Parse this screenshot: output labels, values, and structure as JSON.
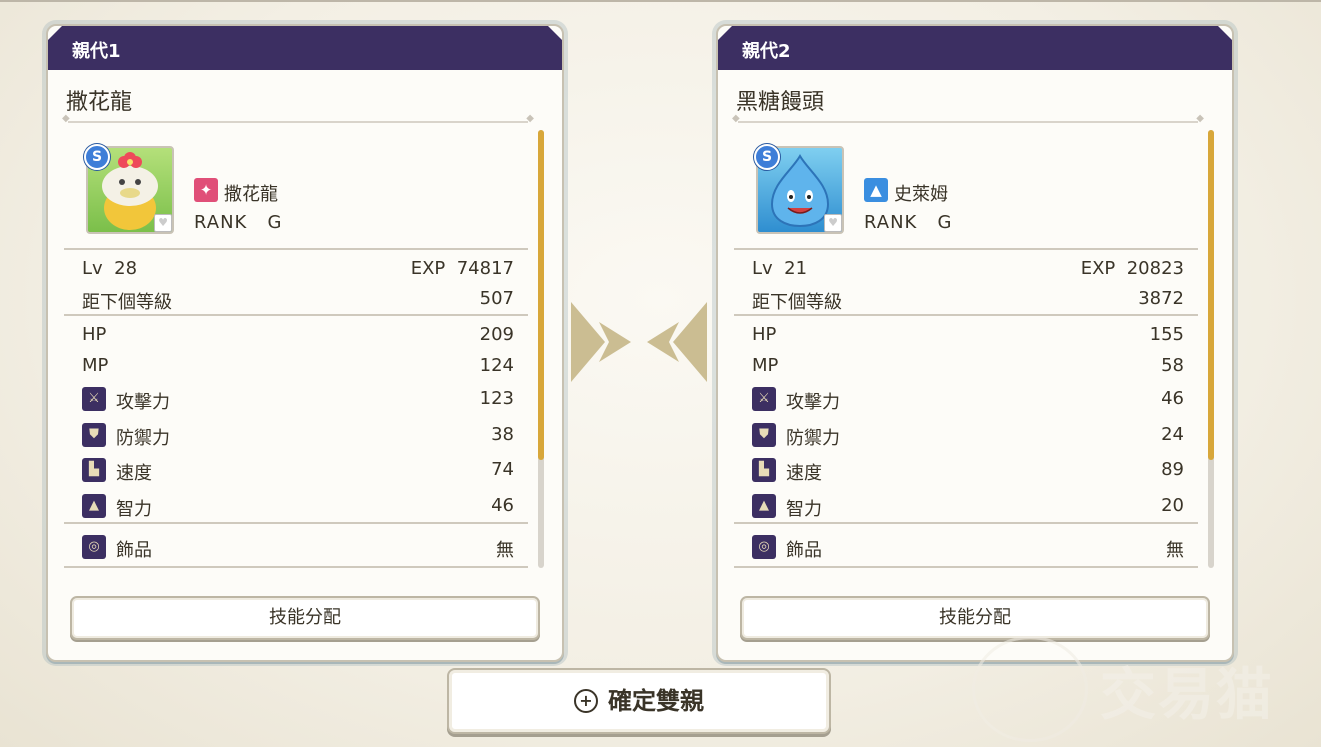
{
  "parents": [
    {
      "header": "親代1",
      "name": "撒花龍",
      "species": "撒花龍",
      "rank_label": "RANK",
      "rank": "G",
      "s_badge": "S",
      "type_icon": "claw-icon",
      "lv_label": "Lv",
      "lv": "28",
      "exp_label": "EXP",
      "exp": "74817",
      "next_label": "距下個等級",
      "next": "507",
      "stats": {
        "hp_label": "HP",
        "hp": "209",
        "mp_label": "MP",
        "mp": "124",
        "atk_label": "攻擊力",
        "atk": "123",
        "def_label": "防禦力",
        "def": "38",
        "spd_label": "速度",
        "spd": "74",
        "int_label": "智力",
        "int": "46"
      },
      "accessory_label": "飾品",
      "accessory": "無",
      "skill_button": "技能分配"
    },
    {
      "header": "親代2",
      "name": "黑糖饅頭",
      "species": "史萊姆",
      "rank_label": "RANK",
      "rank": "G",
      "s_badge": "S",
      "type_icon": "slime-drop-icon",
      "lv_label": "Lv",
      "lv": "21",
      "exp_label": "EXP",
      "exp": "20823",
      "next_label": "距下個等級",
      "next": "3872",
      "stats": {
        "hp_label": "HP",
        "hp": "155",
        "mp_label": "MP",
        "mp": "58",
        "atk_label": "攻擊力",
        "atk": "46",
        "def_label": "防禦力",
        "def": "24",
        "spd_label": "速度",
        "spd": "89",
        "int_label": "智力",
        "int": "20"
      },
      "accessory_label": "飾品",
      "accessory": "無",
      "skill_button": "技能分配"
    }
  ],
  "confirm_button": "確定雙親",
  "watermark": "交易猫",
  "colors": {
    "header": "#3c2f62",
    "scroll_thumb": "#d8a73a",
    "arrow_gold": "#c8b78a"
  }
}
